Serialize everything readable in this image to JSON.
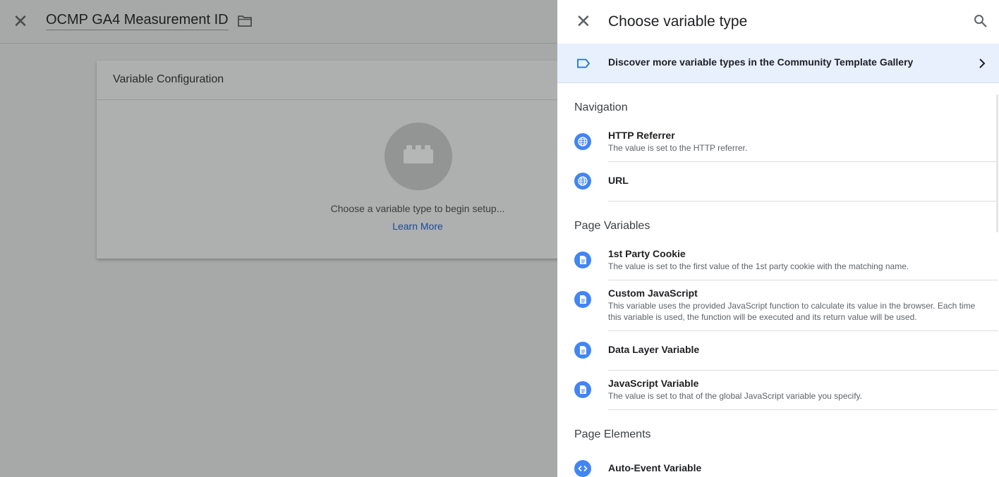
{
  "background": {
    "title": "OCMP GA4 Measurement ID",
    "card_title": "Variable Configuration",
    "card_message": "Choose a variable type to begin setup...",
    "card_link": "Learn More"
  },
  "panel": {
    "title": "Choose variable type",
    "banner_text": "Discover more variable types in the Community Template Gallery",
    "sections": {
      "navigation": "Navigation",
      "page_variables": "Page Variables",
      "page_elements": "Page Elements"
    },
    "items": [
      {
        "name": "HTTP Referrer",
        "desc": "The value is set to the HTTP referrer.",
        "icon": "globe-icon"
      },
      {
        "name": "URL",
        "desc": "",
        "icon": "globe-icon"
      },
      {
        "name": "1st Party Cookie",
        "desc": "The value is set to the first value of the 1st party cookie with the matching name.",
        "icon": "document-icon"
      },
      {
        "name": "Custom JavaScript",
        "desc": "This variable uses the provided JavaScript function to calculate its value in the browser. Each time this variable is used, the function will be executed and its return value will be used.",
        "icon": "document-icon"
      },
      {
        "name": "Data Layer Variable",
        "desc": "",
        "icon": "document-icon"
      },
      {
        "name": "JavaScript Variable",
        "desc": "The value is set to that of the global JavaScript variable you specify.",
        "icon": "document-icon"
      },
      {
        "name": "Auto-Event Variable",
        "desc": "",
        "icon": "code-icon"
      }
    ]
  },
  "colors": {
    "accent": "#4285f4",
    "banner_bg": "#e8f0fe",
    "overlay": "#a7a8a8",
    "link": "#1a73e8"
  }
}
